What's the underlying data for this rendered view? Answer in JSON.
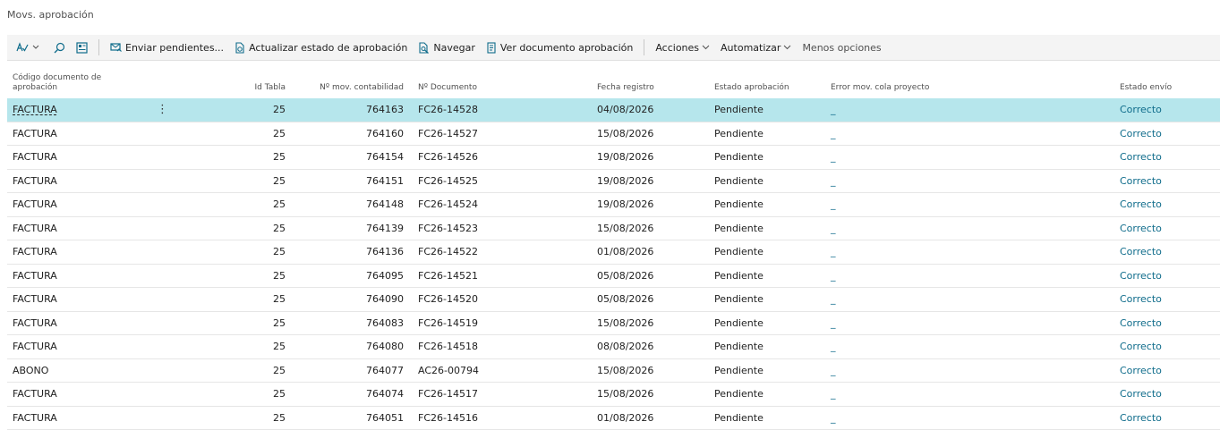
{
  "page": {
    "title": "Movs. aprobación"
  },
  "toolbar": {
    "icons": [
      "spell-check-icon",
      "search-icon",
      "layout-icon"
    ],
    "buttons": [
      {
        "label": "Enviar pendientes...",
        "icon": "send-mail-icon"
      },
      {
        "label": "Actualizar estado de aprobación",
        "icon": "refresh-doc-icon"
      },
      {
        "label": "Navegar",
        "icon": "navigate-icon"
      },
      {
        "label": "Ver documento aprobación",
        "icon": "document-icon"
      }
    ],
    "menus": [
      {
        "label": "Acciones"
      },
      {
        "label": "Automatizar"
      },
      {
        "label": "Menos opciones"
      }
    ]
  },
  "columns": {
    "codigo": "Código documento de aprobación",
    "id_tabla": "Id Tabla",
    "n_mov": "Nº mov. contabilidad",
    "n_doc": "Nº Documento",
    "fecha": "Fecha registro",
    "estado": "Estado aprobación",
    "error": "Error mov. cola proyecto",
    "envio": "Estado envío"
  },
  "rows": [
    {
      "codigo": "FACTURA",
      "id_tabla": "25",
      "n_mov": "764163",
      "n_doc": "FC26-14528",
      "fecha": "04/08/2026",
      "estado": "Pendiente",
      "error": "_",
      "envio": "Correcto"
    },
    {
      "codigo": "FACTURA",
      "id_tabla": "25",
      "n_mov": "764160",
      "n_doc": "FC26-14527",
      "fecha": "15/08/2026",
      "estado": "Pendiente",
      "error": "_",
      "envio": "Correcto"
    },
    {
      "codigo": "FACTURA",
      "id_tabla": "25",
      "n_mov": "764154",
      "n_doc": "FC26-14526",
      "fecha": "19/08/2026",
      "estado": "Pendiente",
      "error": "_",
      "envio": "Correcto"
    },
    {
      "codigo": "FACTURA",
      "id_tabla": "25",
      "n_mov": "764151",
      "n_doc": "FC26-14525",
      "fecha": "19/08/2026",
      "estado": "Pendiente",
      "error": "_",
      "envio": "Correcto"
    },
    {
      "codigo": "FACTURA",
      "id_tabla": "25",
      "n_mov": "764148",
      "n_doc": "FC26-14524",
      "fecha": "19/08/2026",
      "estado": "Pendiente",
      "error": "_",
      "envio": "Correcto"
    },
    {
      "codigo": "FACTURA",
      "id_tabla": "25",
      "n_mov": "764139",
      "n_doc": "FC26-14523",
      "fecha": "15/08/2026",
      "estado": "Pendiente",
      "error": "_",
      "envio": "Correcto"
    },
    {
      "codigo": "FACTURA",
      "id_tabla": "25",
      "n_mov": "764136",
      "n_doc": "FC26-14522",
      "fecha": "01/08/2026",
      "estado": "Pendiente",
      "error": "_",
      "envio": "Correcto"
    },
    {
      "codigo": "FACTURA",
      "id_tabla": "25",
      "n_mov": "764095",
      "n_doc": "FC26-14521",
      "fecha": "05/08/2026",
      "estado": "Pendiente",
      "error": "_",
      "envio": "Correcto"
    },
    {
      "codigo": "FACTURA",
      "id_tabla": "25",
      "n_mov": "764090",
      "n_doc": "FC26-14520",
      "fecha": "05/08/2026",
      "estado": "Pendiente",
      "error": "_",
      "envio": "Correcto"
    },
    {
      "codigo": "FACTURA",
      "id_tabla": "25",
      "n_mov": "764083",
      "n_doc": "FC26-14519",
      "fecha": "15/08/2026",
      "estado": "Pendiente",
      "error": "_",
      "envio": "Correcto"
    },
    {
      "codigo": "FACTURA",
      "id_tabla": "25",
      "n_mov": "764080",
      "n_doc": "FC26-14518",
      "fecha": "08/08/2026",
      "estado": "Pendiente",
      "error": "_",
      "envio": "Correcto"
    },
    {
      "codigo": "ABONO",
      "id_tabla": "25",
      "n_mov": "764077",
      "n_doc": "AC26-00794",
      "fecha": "15/08/2026",
      "estado": "Pendiente",
      "error": "_",
      "envio": "Correcto"
    },
    {
      "codigo": "FACTURA",
      "id_tabla": "25",
      "n_mov": "764074",
      "n_doc": "FC26-14517",
      "fecha": "15/08/2026",
      "estado": "Pendiente",
      "error": "_",
      "envio": "Correcto"
    },
    {
      "codigo": "FACTURA",
      "id_tabla": "25",
      "n_mov": "764051",
      "n_doc": "FC26-14516",
      "fecha": "01/08/2026",
      "estado": "Pendiente",
      "error": "_",
      "envio": "Correcto"
    }
  ],
  "selected_row": 0,
  "colors": {
    "selected_row": "#b6e6ec",
    "link": "#0f6c8b",
    "toolbar_bg": "#f4f4f4"
  }
}
